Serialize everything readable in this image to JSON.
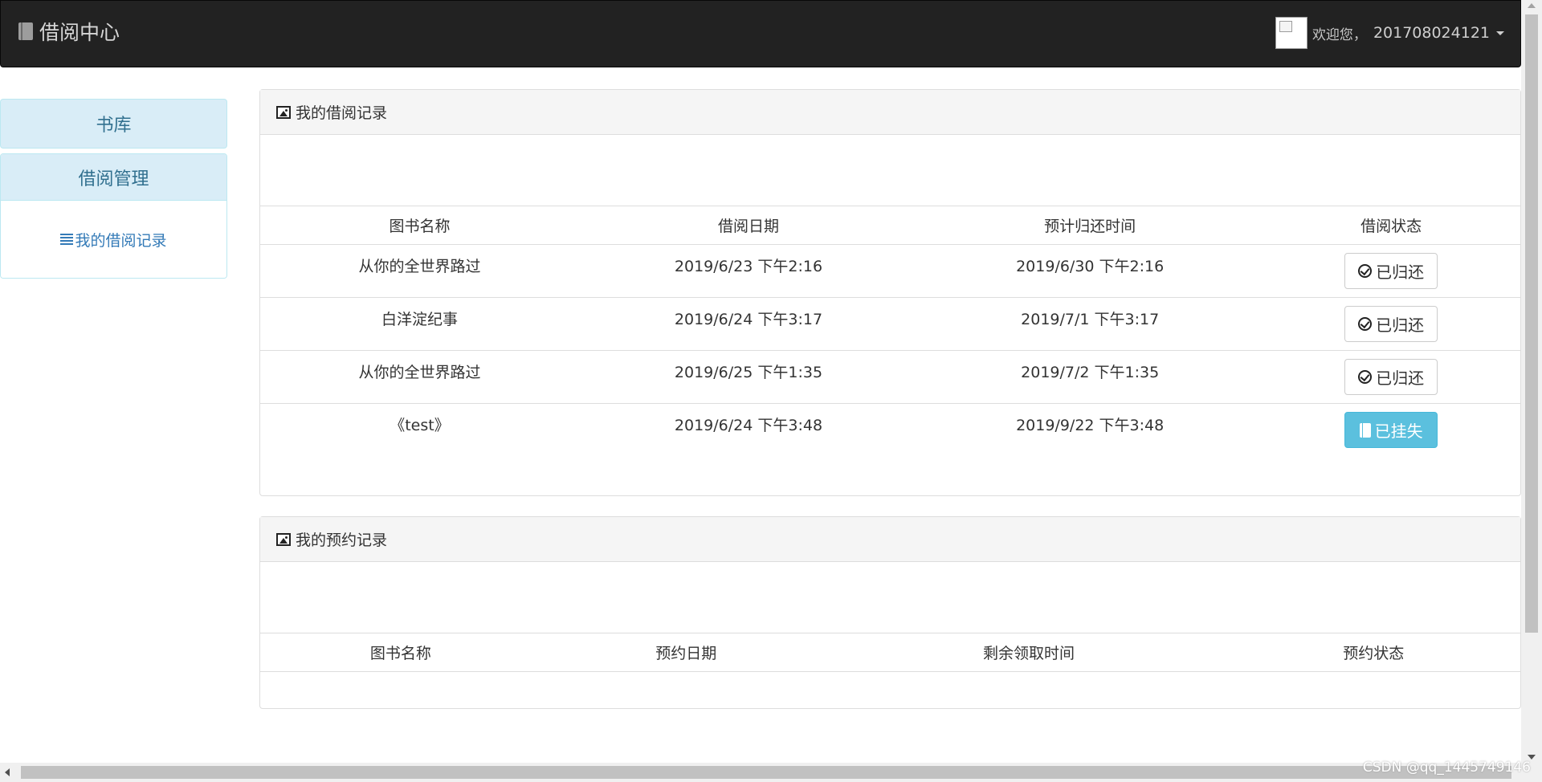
{
  "navbar": {
    "brand": "借阅中心",
    "welcome": "欢迎您，",
    "user_id": "201708024121"
  },
  "sidebar": {
    "library": "书库",
    "borrow_manage": "借阅管理",
    "my_borrow_records": "我的借阅记录"
  },
  "borrow_panel": {
    "title": "我的借阅记录",
    "columns": [
      "图书名称",
      "借阅日期",
      "预计归还时间",
      "借阅状态"
    ],
    "rows": [
      {
        "name": "从你的全世界路过",
        "borrow_date": "2019/6/23 下午2:16",
        "due_date": "2019/6/30 下午2:16",
        "status": "已归还"
      },
      {
        "name": "白洋淀纪事",
        "borrow_date": "2019/6/24 下午3:17",
        "due_date": "2019/7/1 下午3:17",
        "status": "已归还"
      },
      {
        "name": "从你的全世界路过",
        "borrow_date": "2019/6/25 下午1:35",
        "due_date": "2019/7/2 下午1:35",
        "status": "已归还"
      },
      {
        "name": "《test》",
        "borrow_date": "2019/6/24 下午3:48",
        "due_date": "2019/9/22 下午3:48",
        "status": "已挂失"
      }
    ]
  },
  "reserve_panel": {
    "title": "我的预约记录",
    "columns": [
      "图书名称",
      "预约日期",
      "剩余领取时间",
      "预约状态"
    ]
  },
  "watermark": "CSDN @qq_1445749146",
  "colors": {
    "navbar_bg": "#222222",
    "sidebar_bg": "#d9edf7",
    "sidebar_text": "#31708f",
    "link": "#337ab7",
    "info_button": "#5bc0de"
  },
  "icons": {
    "brand": "book-icon",
    "panel": "picture-icon",
    "returned": "check-circle-icon",
    "lost": "book-icon",
    "sidebar_item": "list-icon"
  }
}
